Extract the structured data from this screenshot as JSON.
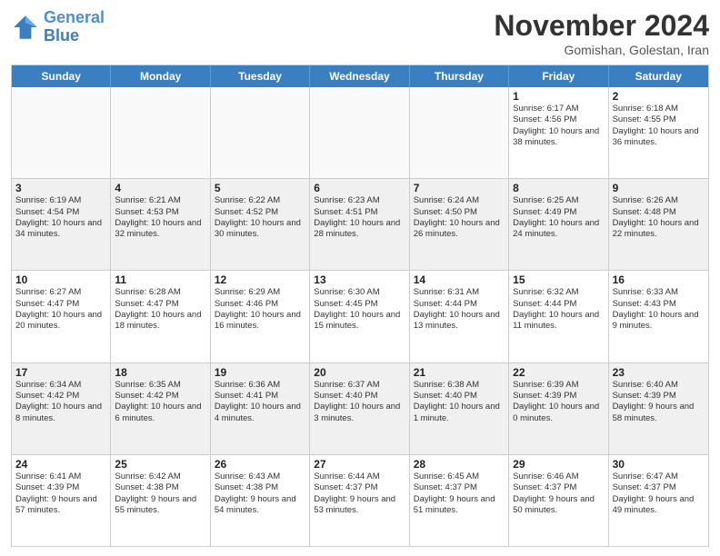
{
  "header": {
    "logo_line1": "General",
    "logo_line2": "Blue",
    "month": "November 2024",
    "location": "Gomishan, Golestan, Iran"
  },
  "days_of_week": [
    "Sunday",
    "Monday",
    "Tuesday",
    "Wednesday",
    "Thursday",
    "Friday",
    "Saturday"
  ],
  "weeks": [
    [
      {
        "day": "",
        "info": ""
      },
      {
        "day": "",
        "info": ""
      },
      {
        "day": "",
        "info": ""
      },
      {
        "day": "",
        "info": ""
      },
      {
        "day": "",
        "info": ""
      },
      {
        "day": "1",
        "info": "Sunrise: 6:17 AM\nSunset: 4:56 PM\nDaylight: 10 hours\nand 38 minutes."
      },
      {
        "day": "2",
        "info": "Sunrise: 6:18 AM\nSunset: 4:55 PM\nDaylight: 10 hours\nand 36 minutes."
      }
    ],
    [
      {
        "day": "3",
        "info": "Sunrise: 6:19 AM\nSunset: 4:54 PM\nDaylight: 10 hours\nand 34 minutes."
      },
      {
        "day": "4",
        "info": "Sunrise: 6:21 AM\nSunset: 4:53 PM\nDaylight: 10 hours\nand 32 minutes."
      },
      {
        "day": "5",
        "info": "Sunrise: 6:22 AM\nSunset: 4:52 PM\nDaylight: 10 hours\nand 30 minutes."
      },
      {
        "day": "6",
        "info": "Sunrise: 6:23 AM\nSunset: 4:51 PM\nDaylight: 10 hours\nand 28 minutes."
      },
      {
        "day": "7",
        "info": "Sunrise: 6:24 AM\nSunset: 4:50 PM\nDaylight: 10 hours\nand 26 minutes."
      },
      {
        "day": "8",
        "info": "Sunrise: 6:25 AM\nSunset: 4:49 PM\nDaylight: 10 hours\nand 24 minutes."
      },
      {
        "day": "9",
        "info": "Sunrise: 6:26 AM\nSunset: 4:48 PM\nDaylight: 10 hours\nand 22 minutes."
      }
    ],
    [
      {
        "day": "10",
        "info": "Sunrise: 6:27 AM\nSunset: 4:47 PM\nDaylight: 10 hours\nand 20 minutes."
      },
      {
        "day": "11",
        "info": "Sunrise: 6:28 AM\nSunset: 4:47 PM\nDaylight: 10 hours\nand 18 minutes."
      },
      {
        "day": "12",
        "info": "Sunrise: 6:29 AM\nSunset: 4:46 PM\nDaylight: 10 hours\nand 16 minutes."
      },
      {
        "day": "13",
        "info": "Sunrise: 6:30 AM\nSunset: 4:45 PM\nDaylight: 10 hours\nand 15 minutes."
      },
      {
        "day": "14",
        "info": "Sunrise: 6:31 AM\nSunset: 4:44 PM\nDaylight: 10 hours\nand 13 minutes."
      },
      {
        "day": "15",
        "info": "Sunrise: 6:32 AM\nSunset: 4:44 PM\nDaylight: 10 hours\nand 11 minutes."
      },
      {
        "day": "16",
        "info": "Sunrise: 6:33 AM\nSunset: 4:43 PM\nDaylight: 10 hours\nand 9 minutes."
      }
    ],
    [
      {
        "day": "17",
        "info": "Sunrise: 6:34 AM\nSunset: 4:42 PM\nDaylight: 10 hours\nand 8 minutes."
      },
      {
        "day": "18",
        "info": "Sunrise: 6:35 AM\nSunset: 4:42 PM\nDaylight: 10 hours\nand 6 minutes."
      },
      {
        "day": "19",
        "info": "Sunrise: 6:36 AM\nSunset: 4:41 PM\nDaylight: 10 hours\nand 4 minutes."
      },
      {
        "day": "20",
        "info": "Sunrise: 6:37 AM\nSunset: 4:40 PM\nDaylight: 10 hours\nand 3 minutes."
      },
      {
        "day": "21",
        "info": "Sunrise: 6:38 AM\nSunset: 4:40 PM\nDaylight: 10 hours\nand 1 minute."
      },
      {
        "day": "22",
        "info": "Sunrise: 6:39 AM\nSunset: 4:39 PM\nDaylight: 10 hours\nand 0 minutes."
      },
      {
        "day": "23",
        "info": "Sunrise: 6:40 AM\nSunset: 4:39 PM\nDaylight: 9 hours\nand 58 minutes."
      }
    ],
    [
      {
        "day": "24",
        "info": "Sunrise: 6:41 AM\nSunset: 4:39 PM\nDaylight: 9 hours\nand 57 minutes."
      },
      {
        "day": "25",
        "info": "Sunrise: 6:42 AM\nSunset: 4:38 PM\nDaylight: 9 hours\nand 55 minutes."
      },
      {
        "day": "26",
        "info": "Sunrise: 6:43 AM\nSunset: 4:38 PM\nDaylight: 9 hours\nand 54 minutes."
      },
      {
        "day": "27",
        "info": "Sunrise: 6:44 AM\nSunset: 4:37 PM\nDaylight: 9 hours\nand 53 minutes."
      },
      {
        "day": "28",
        "info": "Sunrise: 6:45 AM\nSunset: 4:37 PM\nDaylight: 9 hours\nand 51 minutes."
      },
      {
        "day": "29",
        "info": "Sunrise: 6:46 AM\nSunset: 4:37 PM\nDaylight: 9 hours\nand 50 minutes."
      },
      {
        "day": "30",
        "info": "Sunrise: 6:47 AM\nSunset: 4:37 PM\nDaylight: 9 hours\nand 49 minutes."
      }
    ]
  ]
}
